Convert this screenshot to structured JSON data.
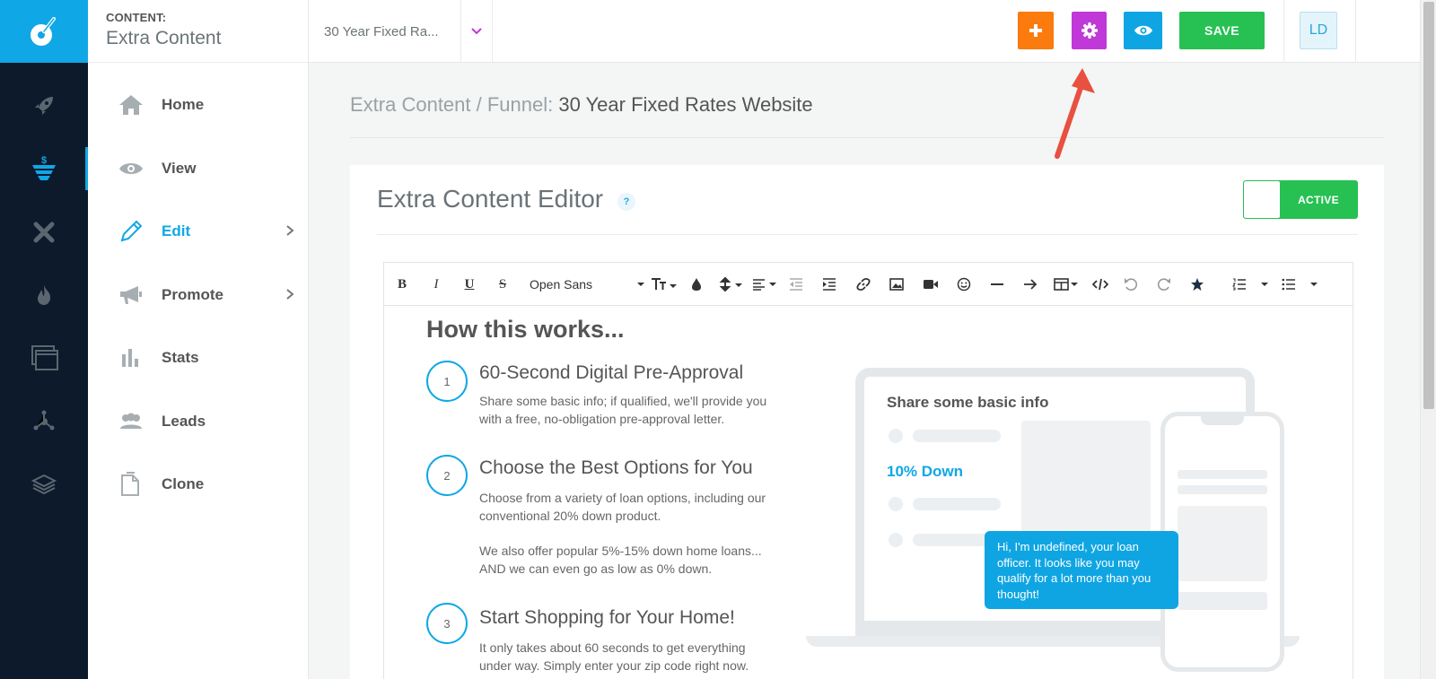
{
  "rail": {
    "items": [
      {
        "icon": "rocket-icon"
      },
      {
        "icon": "funnel-dollar-icon",
        "active": true
      },
      {
        "icon": "tools-icon"
      },
      {
        "icon": "flame-icon"
      },
      {
        "icon": "windows-icon"
      },
      {
        "icon": "network-icon"
      },
      {
        "icon": "layers-icon"
      }
    ]
  },
  "nav": {
    "kicker": "CONTENT:",
    "title": "Extra Content",
    "items": [
      {
        "label": "Home",
        "icon": "home-icon"
      },
      {
        "label": "View",
        "icon": "eye-icon"
      },
      {
        "label": "Edit",
        "icon": "pencil-icon",
        "active": true,
        "has_submenu": true
      },
      {
        "label": "Promote",
        "icon": "megaphone-icon",
        "has_submenu": true
      },
      {
        "label": "Stats",
        "icon": "bar-chart-icon"
      },
      {
        "label": "Leads",
        "icon": "users-icon"
      },
      {
        "label": "Clone",
        "icon": "copy-icon"
      }
    ]
  },
  "topbar": {
    "funnel_select": "30 Year Fixed Ra...",
    "save_label": "SAVE",
    "avatar_initials": "LD",
    "colors": {
      "add": "#fb7b0f",
      "settings": "#c038d8",
      "preview": "#0fa5e3",
      "save": "#26c152"
    }
  },
  "breadcrumb": {
    "prefix": "Extra Content / Funnel: ",
    "current": "30 Year Fixed Rates Website"
  },
  "editor_card": {
    "title": "Extra Content Editor",
    "help": "?",
    "status_label": "ACTIVE",
    "toolbar": {
      "bold": "B",
      "italic": "I",
      "underline": "U",
      "strike": "S",
      "font": "Open Sans"
    }
  },
  "content": {
    "heading": "How this works...",
    "steps": [
      {
        "num": "1",
        "title": "60-Second Digital Pre-Approval",
        "text": "Share some basic info; if qualified, we'll provide you with a free, no-obligation pre-approval letter."
      },
      {
        "num": "2",
        "title": "Choose the Best Options for You",
        "text": "Choose from a variety of loan options, including our conventional 20% down product.",
        "text2": "We also offer popular 5%-15% down home loans... AND we can even go as low as 0% down."
      },
      {
        "num": "3",
        "title": "Start Shopping for Your Home!",
        "text": "It only takes about 60 seconds to get everything under way. Simply enter your zip code right now."
      }
    ],
    "illustration": {
      "heading": "Share some basic info",
      "highlight": "10% Down",
      "bubble": "Hi, I'm undefined, your loan officer. It looks like you may qualify for a lot more than you thought!"
    }
  }
}
